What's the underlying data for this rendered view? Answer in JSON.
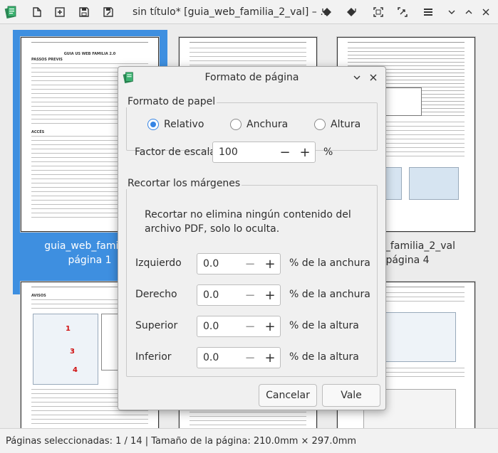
{
  "window": {
    "title": "sin título* [guia_web_familia_2_val] – …"
  },
  "toolbar_icons": [
    "app-icon",
    "open-icon",
    "add-icon",
    "save-icon",
    "save-as-icon",
    "rotate-left-icon",
    "rotate-right-icon",
    "crop-icon",
    "zoom-icon",
    "menu-icon",
    "minimize-icon",
    "maximize-icon",
    "close-icon"
  ],
  "thumbnails": [
    {
      "caption_line1": "guia_web_familia_",
      "caption_line2": "página 1",
      "selected": true
    },
    {
      "caption_line1": "_web_familia_2_val",
      "caption_line2": "página 4",
      "selected": false
    }
  ],
  "page_marks": [
    "1",
    "3",
    "4"
  ],
  "page_texts": {
    "p1_heading": "GUIA US WEB FAMILIA 2.0",
    "p1_subheading": "PASSOS PREVIS",
    "p1_section": "ACCÉS",
    "p5_heading": "AVISOS"
  },
  "dialog": {
    "title": "Formato de página",
    "paper_format": {
      "label": "Formato de papel",
      "options": [
        {
          "label": "Relativo",
          "selected": true
        },
        {
          "label": "Anchura",
          "selected": false
        },
        {
          "label": "Altura",
          "selected": false
        }
      ],
      "scale_label": "Factor de escala",
      "scale_value": "100",
      "scale_unit": "%"
    },
    "crop": {
      "label": "Recortar los márgenes",
      "note": "Recortar no elimina ningún contenido del archivo PDF, solo lo oculta.",
      "rows": [
        {
          "label": "Izquierdo",
          "value": "0.0",
          "unit": "% de la anchura"
        },
        {
          "label": "Derecho",
          "value": "0.0",
          "unit": "% de la anchura"
        },
        {
          "label": "Superior",
          "value": "0.0",
          "unit": "% de la altura"
        },
        {
          "label": "Inferior",
          "value": "0.0",
          "unit": "% de la altura"
        }
      ]
    },
    "cancel_label": "Cancelar",
    "ok_label": "Vale"
  },
  "status": {
    "text": "Páginas seleccionadas: 1 / 14 | Tamaño de la página: 210.0mm × 297.0mm"
  },
  "colors": {
    "accent": "#3584e4",
    "selection": "#3e8fe0"
  }
}
